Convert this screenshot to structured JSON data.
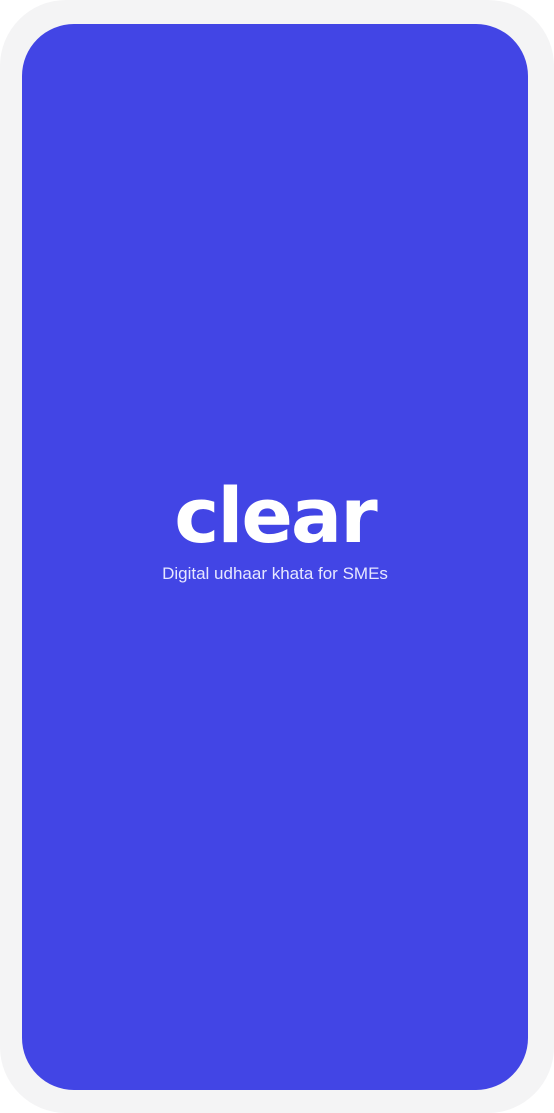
{
  "colors": {
    "frame": "#f4f4f5",
    "screen_background": "#4245e5",
    "logo_text": "#ffffff",
    "tagline_text": "#e6e7ff"
  },
  "splash": {
    "logo_text": "clear",
    "tagline": "Digital udhaar khata for SMEs"
  }
}
